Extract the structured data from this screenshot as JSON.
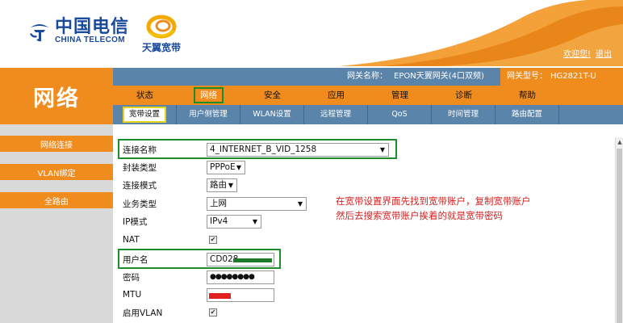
{
  "header": {
    "brand_cn": "中国电信",
    "brand_en": "CHINA TELECOM",
    "sub_brand": "天翼宽带",
    "links": [
      "欢迎您!",
      "退出"
    ]
  },
  "gateway": {
    "name_label": "网关名称：",
    "name_value": "EPON天翼网关(4口双频)",
    "model_label": "网关型号：",
    "model_value": "HG2821T-U"
  },
  "section_title": "网络",
  "sidebar": {
    "items": [
      {
        "label": "网络连接"
      },
      {
        "label": "VLAN绑定"
      },
      {
        "label": "全路由"
      }
    ]
  },
  "nav": {
    "primary": [
      "状态",
      "网络",
      "安全",
      "应用",
      "管理",
      "诊断",
      "帮助"
    ],
    "primary_active": "网络",
    "secondary": [
      "宽带设置",
      "用户侧管理",
      "WLAN设置",
      "远程管理",
      "QoS",
      "时间管理",
      "路由配置",
      ""
    ],
    "secondary_active": "宽带设置"
  },
  "form": {
    "connection_name": {
      "label": "连接名称",
      "value": "4_INTERNET_B_VID_1258"
    },
    "encapsulation": {
      "label": "封装类型",
      "value": "PPPoE"
    },
    "connection_mode": {
      "label": "连接模式",
      "value": "路由"
    },
    "service_type": {
      "label": "业务类型",
      "value": "上网"
    },
    "ip_mode": {
      "label": "IP模式",
      "value": "IPv4"
    },
    "nat": {
      "label": "NAT",
      "checked": true
    },
    "username": {
      "label": "用户名",
      "value": "CD028"
    },
    "password": {
      "label": "密码",
      "value": "●●●●●●●●"
    },
    "mtu": {
      "label": "MTU",
      "value": ""
    },
    "enable_vlan": {
      "label": "启用VLAN",
      "checked": true
    }
  },
  "annotation": {
    "line1": "在宽带设置界面先找到宽带账户，复制宽带账户",
    "line2": "然后去搜索宽带账户挨着的就是宽带密码"
  },
  "colors": {
    "orange": "#f08c1e",
    "steel_blue": "#5a84a9",
    "highlight_green": "#1e8c2a",
    "highlight_yellow": "#e8d21a",
    "annotation_red": "#d42020",
    "redaction_green": "#1e7a2a",
    "redaction_red": "#e02020"
  },
  "icons": [
    "china-telecom-logo-icon",
    "tianyi-logo-icon",
    "dropdown-arrow-icon",
    "checkmark-icon",
    "scroll-up-icon"
  ]
}
